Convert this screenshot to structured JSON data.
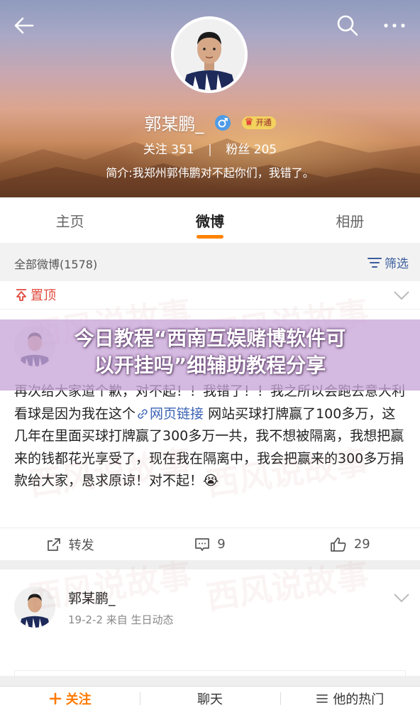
{
  "profile": {
    "name": "郭某鹏_",
    "vip_label": "开通",
    "following_label": "关注",
    "following_count": "351",
    "followers_label": "粉丝",
    "followers_count": "205",
    "bio": "简介:我郑州郭伟鹏对不起你们，我错了。"
  },
  "tabs": [
    {
      "label": "主页"
    },
    {
      "label": "微博"
    },
    {
      "label": "相册"
    }
  ],
  "filter": {
    "all_posts_label": "全部微博(1578)",
    "filter_label": "筛选"
  },
  "pinned": {
    "label": "置顶"
  },
  "overlay": {
    "line1": "今日教程“西南互娱赌博软件可",
    "line2": "以开挂吗”细辅助教程分享"
  },
  "post": {
    "text_before_link": "再次给大家道个歉，对不起！！我错了！！我之所以会跑去意大利看球是因为我在这个",
    "link_text": "网页链接",
    "text_after_link": " 网站买球打牌赢了100多万，这几年在里面买球打牌赢了300多万一共，我不想被隔离，我想把赢来的钱都花光享受了，现在我在隔离中，我会把赢来的300多万捐款给大家，恳求原谅！对不起！",
    "emoji": "😭",
    "repost_label": "转发",
    "comment_count": "9",
    "like_count": "29"
  },
  "post2": {
    "name": "郭某鹏_",
    "meta": "19-2-2  来自 生日动态"
  },
  "bottom_bar": {
    "follow_label": "关注",
    "chat_label": "聊天",
    "hot_label": "他的热门"
  },
  "watermark_text": "西风说故事",
  "colors": {
    "accent": "#ff8200",
    "link": "#3b63b5",
    "pin": "#e0483b",
    "gender": "#4f9be6"
  }
}
